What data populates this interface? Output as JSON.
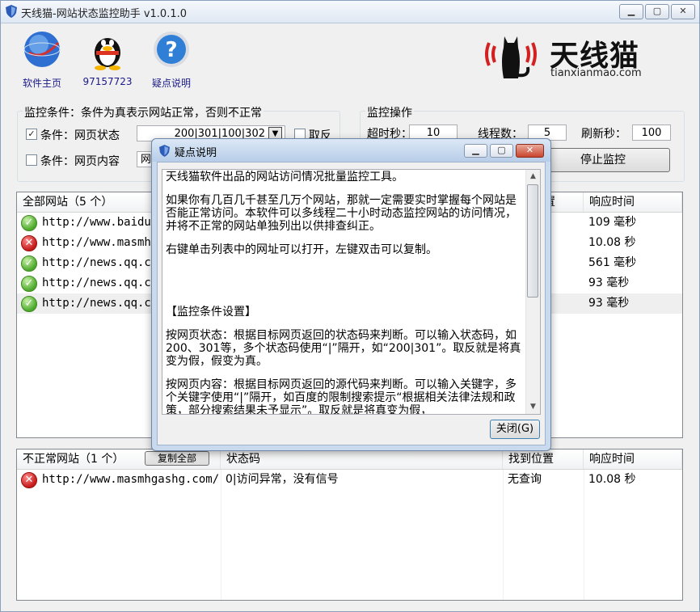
{
  "window": {
    "title": "天线猫-网站状态监控助手 v1.0.1.0"
  },
  "toolbar": [
    {
      "label": "软件主页",
      "icon": "globe-icon"
    },
    {
      "label": "97157723",
      "icon": "qq-penguin-icon"
    },
    {
      "label": "疑点说明",
      "icon": "help-icon"
    }
  ],
  "brand": {
    "name": "天线猫",
    "url": "tianxianmao.com"
  },
  "condition": {
    "legend": "监控条件：条件为真表示网站正常，否则不正常",
    "row1_label": "条件：网页状态",
    "row1_value": "200|301|100|302",
    "row1_checked": true,
    "reverse_label": "取反",
    "row2_label": "条件：网页内容",
    "row2_value": "网"
  },
  "monitor": {
    "legend": "监控操作",
    "timeout_label": "超时秒：",
    "timeout_value": "10",
    "threads_label": "线程数：",
    "threads_value": "5",
    "refresh_label": "刷新秒：",
    "refresh_value": "100",
    "stop_button": "停止监控"
  },
  "all_sites": {
    "headers": [
      "全部网站（5 个）",
      "",
      "置",
      "响应时间"
    ],
    "rows": [
      {
        "url": "http://www.baidu.",
        "status": "ok",
        "time": "109 毫秒"
      },
      {
        "url": "http://www.masmhg",
        "status": "err",
        "time": "10.08 秒"
      },
      {
        "url": "http://news.qq.co",
        "status": "ok",
        "time": "561 毫秒"
      },
      {
        "url": "http://news.qq.co",
        "status": "ok",
        "time": "93 毫秒"
      },
      {
        "url": "http://news.qq.co",
        "status": "ok",
        "time": "93 毫秒"
      }
    ]
  },
  "abnormal_sites": {
    "header_title": "不正常网站（1 个）",
    "copy_all": "复制全部",
    "headers": [
      "状态码",
      "找到位置",
      "响应时间"
    ],
    "rows": [
      {
        "url": "http://www.masmhgashg.com/",
        "code": "0|访问异常，没有信号",
        "found": "无查询",
        "time": "10.08 秒"
      }
    ]
  },
  "dialog": {
    "title": "疑点说明",
    "paragraphs": [
      "天线猫软件出品的网站访问情况批量监控工具。",
      "如果你有几百几千甚至几万个网站，那就一定需要实时掌握每个网站是否能正常访问。本软件可以多线程二十小时动态监控网站的访问情况，并将不正常的网站单独列出以供排查纠正。",
      "右键单击列表中的网址可以打开，左键双击可以复制。",
      "【监控条件设置】",
      "按网页状态：根据目标网页返回的状态码来判断。可以输入状态码，如200、301等，多个状态码使用“|”隔开，如“200|301”。取反就是将真变为假，假变为真。",
      "按网页内容：根据目标网页返回的源代码来判断。可以输入关键字，多个关键字使用“|”隔开，如百度的限制搜索提示“根据相关法律法规和政策，部分搜索结果未予显示”。取反就是将真变为假，"
    ],
    "close_button": "关闭(G)"
  }
}
